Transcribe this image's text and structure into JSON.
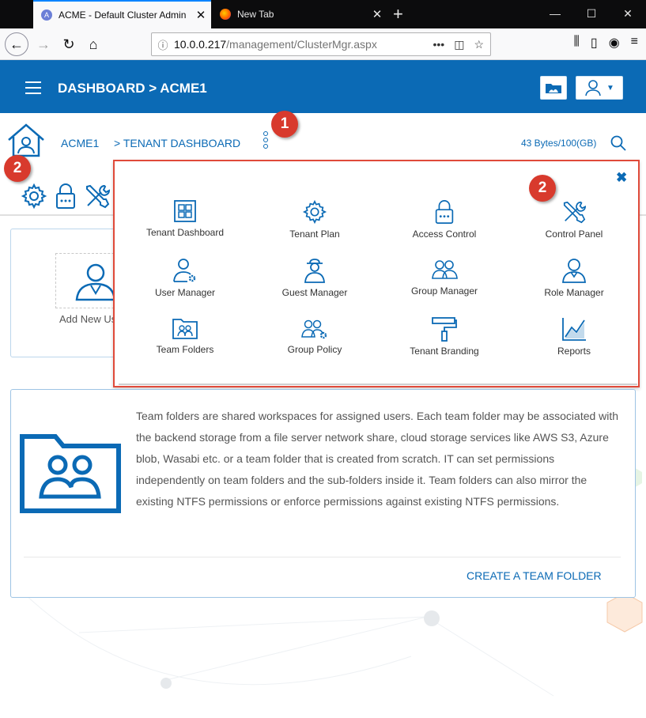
{
  "browser": {
    "tabs": [
      {
        "title": "ACME - Default Cluster Admin",
        "active": true
      },
      {
        "title": "New Tab",
        "active": false
      }
    ],
    "url_host": "10.0.0.217",
    "url_path": "/management/ClusterMgr.aspx",
    "page_actions": "•••"
  },
  "header": {
    "title": "DASHBOARD > ACME1",
    "color": "#0b6ab5"
  },
  "breadcrumb": {
    "root": "ACME1",
    "current": "> TENANT DASHBOARD"
  },
  "storage": "43 Bytes/100(GB)",
  "badges": {
    "kebab": "1",
    "tools": "2",
    "menu": "2"
  },
  "background_card": {
    "add_user_label": "Add New Us"
  },
  "menu": {
    "items": [
      {
        "label": "Tenant Dashboard",
        "icon": "dashboard-grid-icon"
      },
      {
        "label": "Tenant Plan",
        "icon": "gear-icon"
      },
      {
        "label": "Access Control",
        "icon": "lock-icon"
      },
      {
        "label": "Control Panel",
        "icon": "tools-icon"
      },
      {
        "label": "User Manager",
        "icon": "user-gear-icon"
      },
      {
        "label": "Guest Manager",
        "icon": "guest-icon"
      },
      {
        "label": "Group Manager",
        "icon": "group-icon"
      },
      {
        "label": "Role Manager",
        "icon": "role-icon"
      },
      {
        "label": "Team Folders",
        "icon": "team-folder-icon"
      },
      {
        "label": "Group Policy",
        "icon": "group-policy-icon"
      },
      {
        "label": "Tenant Branding",
        "icon": "paint-roller-icon"
      },
      {
        "label": "Reports",
        "icon": "chart-icon"
      }
    ]
  },
  "info": {
    "text": "Team folders are shared workspaces for assigned users. Each team folder may be associated with the backend storage from a file server network share, cloud storage services like AWS S3, Azure blob, Wasabi etc. or a team folder that is created from scratch. IT can set permissions independently on team folders and the sub-folders inside it. Team folders can also mirror the existing NTFS permissions or enforce permissions against existing NTFS permissions.",
    "action": "CREATE A TEAM FOLDER"
  }
}
